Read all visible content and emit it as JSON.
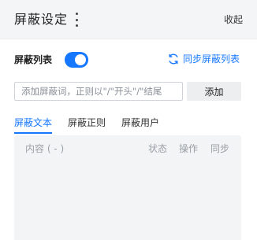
{
  "header": {
    "title": "屏蔽设定",
    "collapse_label": "收起"
  },
  "block_list": {
    "label": "屏蔽列表",
    "enabled": true,
    "sync_label": "同步屏蔽列表"
  },
  "add_form": {
    "placeholder": "添加屏蔽词，正则以\"/\"开头\"/\"结尾",
    "value": "",
    "button_label": "添加"
  },
  "tabs": [
    {
      "label": "屏蔽文本",
      "active": true
    },
    {
      "label": "屏蔽正则",
      "active": false
    },
    {
      "label": "屏蔽用户",
      "active": false
    }
  ],
  "table": {
    "columns": [
      "内容 ( - )",
      "状态",
      "操作",
      "同步"
    ],
    "rows": []
  },
  "colors": {
    "accent": "#1677ff",
    "header_bg": "#f4f5f6",
    "table_bg": "#f3f4f6"
  },
  "icons": {
    "more": "more-vertical-icon",
    "sync": "sync-icon"
  }
}
